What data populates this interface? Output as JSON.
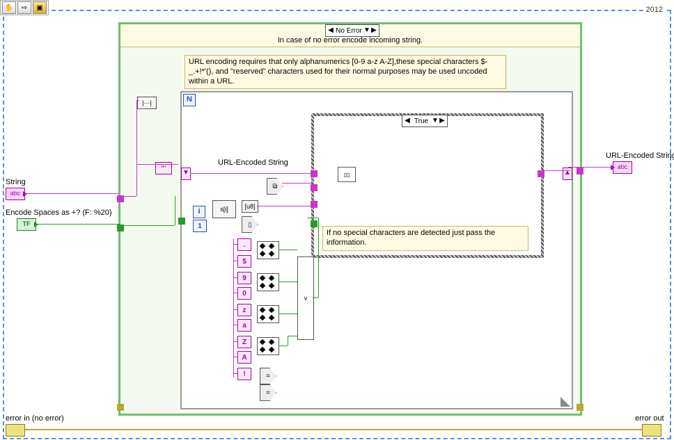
{
  "toolbar": {
    "pan_icon": "✋",
    "arrow_icon": "⇨",
    "highlight_icon": "▣"
  },
  "year": "2012",
  "outer_case": {
    "selector": "No Error",
    "subtitle": "In case of no error encode incoming string."
  },
  "help_box": "URL encoding requires that only alphanumerics [0-9 a-z A-Z],these special characters $-_.+!*'(), and \"reserved\" characters used for their normal purposes may be used uncoded within a URL.",
  "for_loop": {
    "N": "N",
    "i": "i",
    "i_const": "1",
    "url_label": "URL-Encoded String",
    "inner_case": {
      "selector": "True",
      "comment": "If no special characters are detected just pass the information."
    },
    "char_consts": [
      ".",
      "$",
      "9",
      "0",
      "z",
      "a",
      "Z",
      "A",
      "!"
    ],
    "or_label": "v"
  },
  "terminals": {
    "string_in": {
      "label": "String",
      "icon": "abc"
    },
    "encode_spaces": {
      "label": "Encode Spaces as +? (F: %20)",
      "icon": "TF"
    },
    "string_out": {
      "label": "URL-Encoded String",
      "icon": "abc"
    },
    "error_in": {
      "label": "error in (no error)"
    },
    "error_out": {
      "label": "error out"
    }
  },
  "chart_data": {
    "type": "diagram",
    "description": "LabVIEW block diagram for URL-encoding a string",
    "inputs": [
      "String",
      "Encode Spaces as +? (F: %20)",
      "error in (no error)"
    ],
    "outputs": [
      "URL-Encoded String",
      "error out"
    ],
    "outer_structure": {
      "type": "case",
      "shown_frame": "No Error"
    },
    "inner_structure": {
      "type": "for-loop with shift register",
      "inner_case_shown": "True"
    },
    "char_range_checks": [
      {
        "range": [
          "A",
          "Z"
        ]
      },
      {
        "range": [
          "a",
          "z"
        ]
      },
      {
        "range": [
          "0",
          "9"
        ]
      },
      {
        "extra_chars": [
          "$",
          ".",
          "!"
        ]
      }
    ]
  }
}
